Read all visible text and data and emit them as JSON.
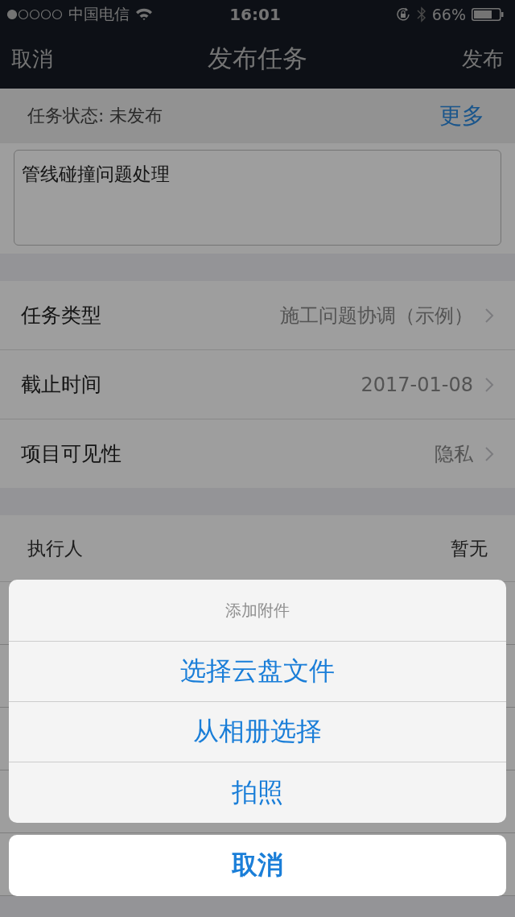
{
  "status_bar": {
    "carrier": "中国电信",
    "time": "16:01",
    "battery": "66%"
  },
  "nav_bar": {
    "cancel": "取消",
    "title": "发布任务",
    "publish": "发布"
  },
  "task_status": {
    "label": "任务状态: 未发布",
    "more": "更多"
  },
  "title_field": {
    "value": "管线碰撞问题处理"
  },
  "fields": [
    {
      "label": "任务类型",
      "value": "施工问题协调（示例）"
    },
    {
      "label": "截止时间",
      "value": "2017-01-08"
    },
    {
      "label": "项目可见性",
      "value": "隐私"
    }
  ],
  "assignee": {
    "label": "执行人",
    "value": "暂无"
  },
  "action_sheet": {
    "title": "添加附件",
    "options": [
      "选择云盘文件",
      "从相册选择",
      "拍照"
    ],
    "cancel": "取消"
  }
}
